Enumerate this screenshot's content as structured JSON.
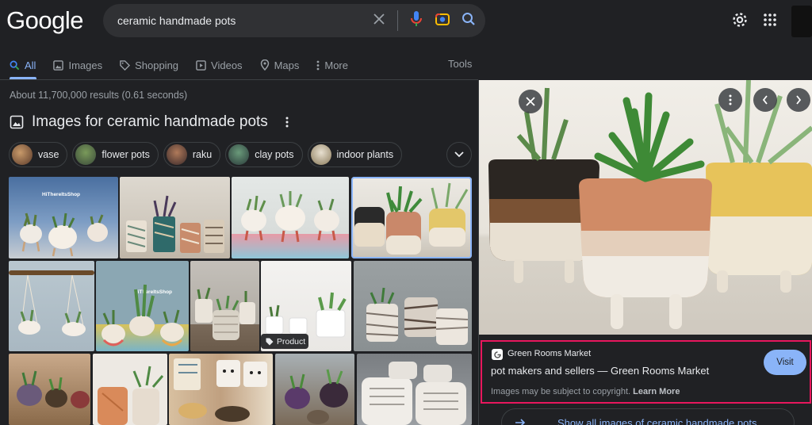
{
  "header": {
    "logo": "Google",
    "search_value": "ceramic handmade pots"
  },
  "tabs": [
    {
      "label": "All",
      "icon": "search-icon",
      "active": true
    },
    {
      "label": "Images",
      "icon": "image-icon"
    },
    {
      "label": "Shopping",
      "icon": "tag-icon"
    },
    {
      "label": "Videos",
      "icon": "play-icon"
    },
    {
      "label": "Maps",
      "icon": "map-pin-icon"
    },
    {
      "label": "More",
      "icon": "vertical-dots-icon"
    }
  ],
  "tools_label": "Tools",
  "result_stats": "About 11,700,000 results (0.61 seconds)",
  "images_heading": "Images for ceramic handmade pots",
  "chips": [
    {
      "label": "vase",
      "color": "#8a6a4a"
    },
    {
      "label": "flower pots",
      "color": "#5a6a4a"
    },
    {
      "label": "raku",
      "color": "#6a4a3a"
    },
    {
      "label": "clay pots",
      "color": "#4a6a5a"
    },
    {
      "label": "indoor plants",
      "color": "#8a7a5a"
    }
  ],
  "tiles": [
    {
      "label": "HiThereItsShop"
    },
    {
      "label": ""
    },
    {
      "label": ""
    },
    {
      "label": ""
    },
    {
      "label": ""
    },
    {
      "label": "HiThereItsShop"
    },
    {
      "label": ""
    },
    {
      "label": ""
    },
    {
      "label": ""
    }
  ],
  "product_badge": "Product",
  "panel": {
    "source_name": "Green Rooms Market",
    "title": "pot makers and sellers — Green Rooms Market",
    "copyright_note": "Images may be subject to copyright.",
    "learn_more": "Learn More",
    "visit_label": "Visit",
    "show_all_label": "Show all images of ceramic handmade pots"
  },
  "colors": {
    "accent": "#8ab4f8",
    "highlight_border": "#e8175d",
    "background": "#202124"
  }
}
